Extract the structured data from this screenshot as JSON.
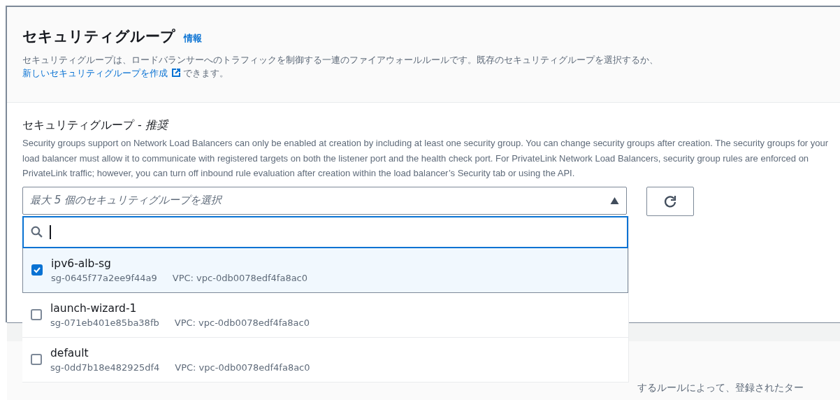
{
  "header": {
    "title": "セキュリティグループ",
    "info_link": "情報",
    "description": "セキュリティグループは、ロードバランサーへのトラフィックを制御する一連のファイアウォールルールです。既存のセキュリティグループを選択するか、",
    "create_link": "新しいセキュリティグループを作成",
    "description_end": "できます。"
  },
  "field": {
    "label": "セキュリティグループ - ",
    "label_emphasis": "推奨",
    "help": "Security groups support on Network Load Balancers can only be enabled at creation by including at least one security group. You can change security groups after creation. The security groups for your load balancer must allow it to communicate with registered targets on both the listener port and the health check port. For PrivateLink Network Load Balancers, security group rules are enforced on PrivateLink traffic; however, you can turn off inbound rule evaluation after creation within the load balancer’s Security tab or using the API.",
    "placeholder": "最大 5 個のセキュリティグループを選択",
    "expanded": true
  },
  "options": [
    {
      "name": "ipv6-alb-sg",
      "id": "sg-0645f77a2ee9f44a9",
      "vpc": "VPC: vpc-0db0078edf4fa8ac0",
      "checked": true
    },
    {
      "name": "launch-wizard-1",
      "id": "sg-071eb401e85ba38fb",
      "vpc": "VPC: vpc-0db0078edf4fa8ac0",
      "checked": false
    },
    {
      "name": "default",
      "id": "sg-0dd7b18e482925df4",
      "vpc": "VPC: vpc-0db0078edf4fa8ac0",
      "checked": false
    }
  ],
  "next_section": {
    "text_fragment": "するルールによって、登録されたター"
  }
}
